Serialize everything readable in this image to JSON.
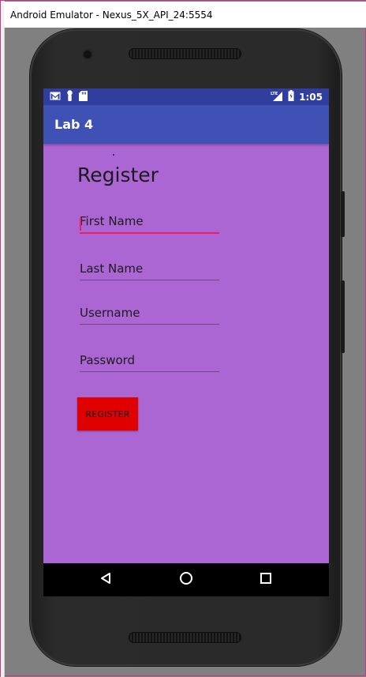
{
  "window": {
    "title": "Android Emulator - Nexus_5X_API_24:5554"
  },
  "status_bar": {
    "time": "1:05",
    "network": "LTE",
    "icons": [
      "gmail-icon",
      "person-icon",
      "sd-card-icon",
      "signal-icon",
      "battery-icon"
    ]
  },
  "app_bar": {
    "title": "Lab 4"
  },
  "form": {
    "title": "Register",
    "first_name_placeholder": "First Name",
    "last_name_placeholder": "Last Name",
    "username_placeholder": "Username",
    "password_placeholder": "Password",
    "register_label": "REGISTER"
  },
  "nav_bar": {
    "icons": [
      "back-icon",
      "home-icon",
      "recents-icon"
    ]
  },
  "colors": {
    "screen_background": "#ab66d4",
    "status_bar": "#303f9f",
    "app_bar": "#3f51b5",
    "register_button": "#e00000",
    "focus_accent": "#e91e63"
  }
}
